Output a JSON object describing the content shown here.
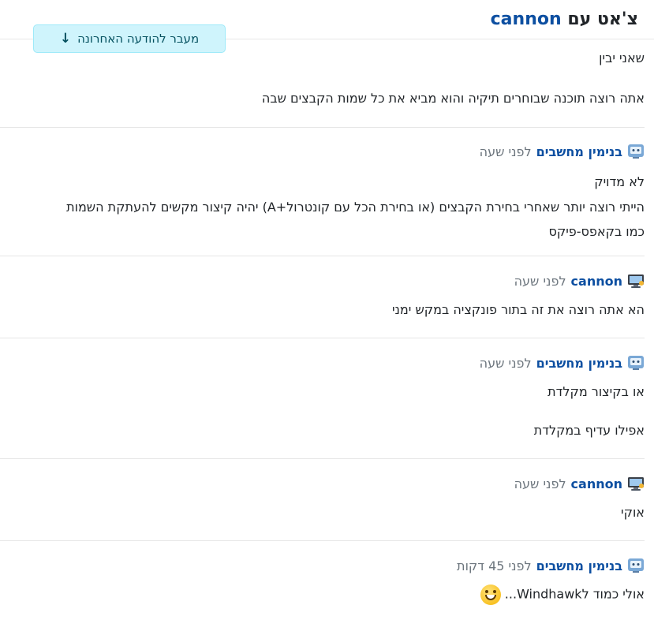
{
  "header": {
    "title_prefix": "צ'אט עם",
    "title_user": "cannon",
    "jump_button": "מעבר להודעה האחרונה"
  },
  "messages": [
    {
      "author": "",
      "time": "",
      "lines": [
        "שאני יבין",
        "אתה רוצה תוכנה שבוחרים תיקיה והוא מביא את כל שמות הקבצים שבה"
      ]
    },
    {
      "author": "בנימין מחשבים",
      "avatar": "computer-robot-icon",
      "time": "לפני שעה",
      "lines": [
        "לא מדויק",
        "הייתי רוצה יותר שאחרי בחירת הקבצים (או בחירת הכל עם קונטרול+A) יהיה קיצור מקשים להעתקת השמות",
        "כמו בקאפס-פיקס"
      ]
    },
    {
      "author": "cannon",
      "avatar": "desktop-computer-icon",
      "time": "לפני שעה",
      "lines": [
        "הא אתה רוצה את זה בתור פונקציה במקש ימני"
      ]
    },
    {
      "author": "בנימין מחשבים",
      "avatar": "computer-robot-icon",
      "time": "לפני שעה",
      "lines": [
        "או בקיצור מקלדת",
        "אפילו עדיף במקלדת"
      ]
    },
    {
      "author": "cannon",
      "avatar": "desktop-computer-icon",
      "time": "לפני שעה",
      "lines": [
        "אוקי"
      ]
    },
    {
      "author": "בנימין מחשבים",
      "avatar": "computer-robot-icon",
      "time": "לפני 45 דקות",
      "lines": [
        "אולי כמוד לWindhawk..."
      ]
    }
  ]
}
